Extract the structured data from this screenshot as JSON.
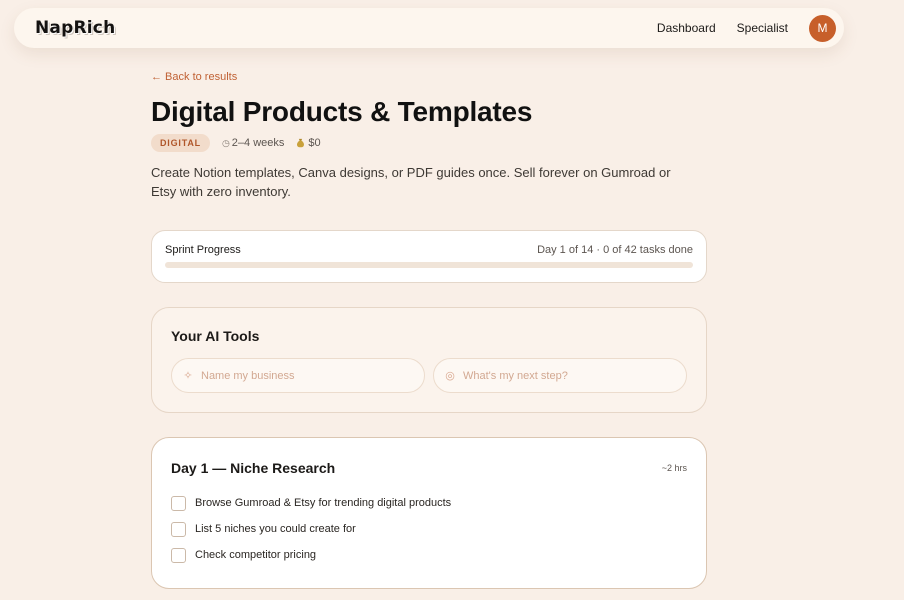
{
  "brand": {
    "logo_text": "NapRich"
  },
  "nav": {
    "links": [
      "Dashboard",
      "Specialist"
    ],
    "avatar_initial": "M",
    "avatar_color": "#c75f2a"
  },
  "back_link": "← Back to results",
  "product": {
    "title": "Digital Products & Templates",
    "tag": "DIGITAL",
    "duration_icon": "clock-icon",
    "duration": "2–4 weeks",
    "cost_icon": "money-bag-icon",
    "cost": "$0",
    "description": "Create Notion templates, Canva designs, or PDF guides once. Sell forever on Gumroad or Etsy with zero inventory."
  },
  "sprint": {
    "title": "Sprint Progress",
    "status": "Day 1 of 14 · 0 of 42 tasks done",
    "progress_fraction": 0
  },
  "ai_tools": {
    "title": "Your AI Tools",
    "inputs": [
      {
        "icon": "sparkle-icon",
        "placeholder": "Name my business",
        "value": ""
      },
      {
        "icon": "target-icon",
        "placeholder": "What's my next step?",
        "value": ""
      }
    ]
  },
  "day": {
    "title": "Day 1 — Niche Research",
    "duration": "~2 hrs",
    "tasks": [
      {
        "label": "Browse Gumroad & Etsy for trending digital products",
        "done": false
      },
      {
        "label": "List 5 niches you could create for",
        "done": false
      },
      {
        "label": "Check competitor pricing",
        "done": false
      }
    ]
  },
  "colors": {
    "accent": "#c75f2a",
    "background": "#f9efe7",
    "tag_bg": "#f2dccb",
    "tag_text": "#b0562a"
  }
}
